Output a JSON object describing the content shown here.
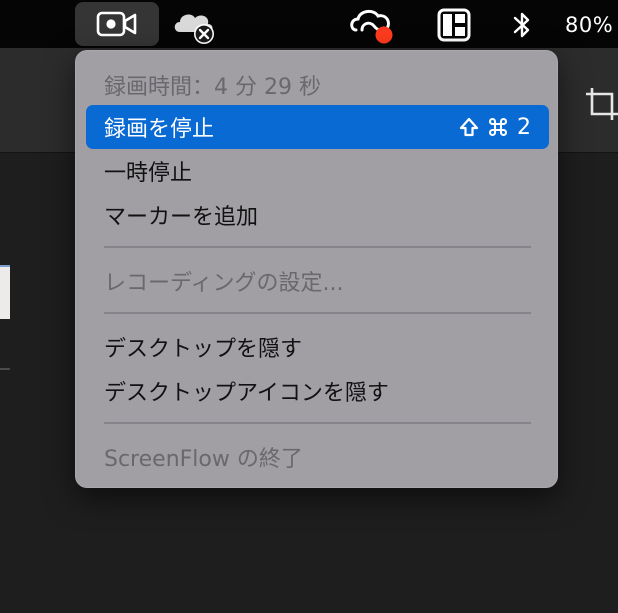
{
  "menubar": {
    "battery_percent": "80%",
    "icons": [
      "screen-recorder-icon",
      "cloud-icon",
      "creative-cloud-icon",
      "window-layout-icon",
      "bluetooth-icon"
    ],
    "badge_color": "#ff3b1f"
  },
  "menu": {
    "recording_time": "録画時間：4 分 29 秒",
    "stop_recording": "録画を停止",
    "stop_shortcut_key": "2",
    "pause": "一時停止",
    "add_marker": "マーカーを追加",
    "recording_settings": "レコーディングの設定...",
    "hide_desktop": "デスクトップを隠す",
    "hide_desktop_icons": "デスクトップアイコンを隠す",
    "quit": "ScreenFlow の終了"
  },
  "colors": {
    "highlight": "#0a6ad3",
    "menu_background": "#a19fa4"
  }
}
